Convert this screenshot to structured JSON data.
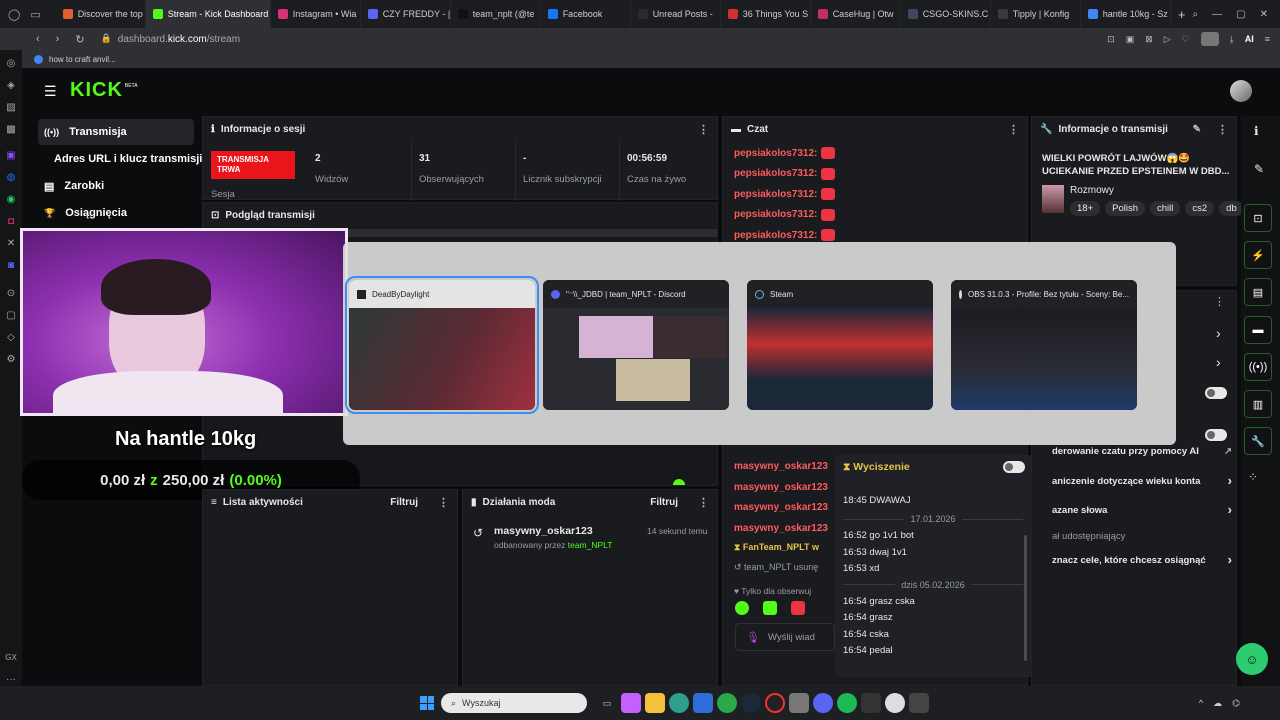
{
  "browser": {
    "tabs": [
      {
        "label": "Discover the top",
        "color": "#e06030"
      },
      {
        "label": "Stream - Kick Dashboard",
        "color": "#53fc18",
        "active": true
      },
      {
        "label": "Instagram • Wia",
        "color": "#d9307a"
      },
      {
        "label": "CZY FREDDY - |",
        "color": "#5865f2"
      },
      {
        "label": "team_nplt (@te",
        "color": "#111111"
      },
      {
        "label": "Facebook",
        "color": "#1877f2"
      },
      {
        "label": "Unread Posts -",
        "color": "#2a2a2a"
      },
      {
        "label": "36 Things You S",
        "color": "#d03030"
      },
      {
        "label": "CaseHug | Otw",
        "color": "#c03060"
      },
      {
        "label": "CSGO-SKINS.C",
        "color": "#404860"
      },
      {
        "label": "Tipply | Konfig",
        "color": "#3a3a3a"
      },
      {
        "label": "hantle 10kg - Sz",
        "color": "#4285f4"
      }
    ],
    "new_tab": "+",
    "url_host": "dashboard.",
    "url_domain": "kick.com",
    "url_path": "/stream",
    "bookmark": "how to craft anvil...",
    "ai_label": "AI"
  },
  "app": {
    "logo": "KICK",
    "logo_badge": "BETA",
    "nav": [
      {
        "icon": "((•))",
        "label": "Transmisja"
      },
      {
        "icon": "",
        "label": "Adres URL i klucz transmisji"
      },
      {
        "icon": "▤",
        "label": "Zarobki"
      },
      {
        "icon": "🏆",
        "label": "Osiągnięcia"
      }
    ],
    "session": {
      "title": "Informacje o sesji",
      "status": "TRANSMISJA TRWA",
      "status_sub": "Sesja",
      "stats": [
        {
          "value": "2",
          "label": "Widzów"
        },
        {
          "value": "31",
          "label": "Obserwujących"
        },
        {
          "value": "-",
          "label": "Licznik subskrypcji"
        },
        {
          "value": "00:56:59",
          "label": "Czas na żywo"
        }
      ]
    },
    "preview_title": "Podgląd transmisji",
    "overlay": {
      "goal_title": "Na hantle 10kg",
      "goal_current": "0,00 zł",
      "goal_sep": "z",
      "goal_target": "250,00 zł",
      "goal_pct": "(0.00%)"
    },
    "activity": {
      "title": "Lista aktywności",
      "filter": "Filtruj"
    },
    "mod": {
      "title": "Działania moda",
      "filter": "Filtruj",
      "user": "masywny_oskar123",
      "time": "14 sekund temu",
      "desc": "odbanowany przez",
      "by": "team_NPLT"
    },
    "chat": {
      "title": "Czat",
      "top_messages": [
        "pepsiakolos7312:",
        "pepsiakolos7312:",
        "pepsiakolos7312:",
        "pepsiakolos7312:",
        "pepsiakolos7312:"
      ],
      "bottom_messages": [
        "masywny_oskar123",
        "masywny_oskar123",
        "masywny_oskar123",
        "masywny_oskar123"
      ],
      "fanteam": "FanTeam_NPLT w",
      "team_line": "team_NPLT usunę",
      "followers_only": "Tylko dla obserwuj",
      "send_placeholder": "Wyślij wiad"
    },
    "timeout": {
      "title": "Wyciszenie",
      "entries": [
        {
          "time": "18:45",
          "text": "DWAWAJ"
        },
        {
          "date": "17.01.2026"
        },
        {
          "time": "16:52",
          "text": "go 1v1 bot"
        },
        {
          "time": "16:53",
          "text": "dwaj 1v1"
        },
        {
          "time": "16:53",
          "text": "xd"
        },
        {
          "date": "dziś 05.02.2026"
        },
        {
          "time": "16:54",
          "text": "grasz cska"
        },
        {
          "time": "16:54",
          "text": "grasz"
        },
        {
          "time": "16:54",
          "text": "cska"
        },
        {
          "time": "16:54",
          "text": "pedal"
        }
      ]
    },
    "stream_info": {
      "title": "Informacje o transmisji",
      "stream_title": "WIELKI POWRÓT LAJWÓW😱🤩 UCIEKANIE PRZED EPSTEINEM W DBD...",
      "category": "Rozmowy",
      "tags": [
        "18+",
        "Polish",
        "chill",
        "cs2",
        "db"
      ]
    },
    "settings_rows": [
      "derowanie czatu przy pomocy AI",
      "aniczenie dotyczące wieku konta",
      "azane słowa",
      "ał udostępniający",
      "znacz cele, które chcesz osiągnąć"
    ]
  },
  "switcher": {
    "windows": [
      {
        "title": "DeadByDaylight",
        "icon": "dbd"
      },
      {
        "title": "\"⁻\\\\_JDBD | team_NPLT - Discord",
        "icon": "discord"
      },
      {
        "title": "Steam",
        "icon": "steam"
      },
      {
        "title": "OBS 31.0.3 - Profile: Bez tytułu - Sceny: Be...",
        "icon": "obs"
      }
    ]
  },
  "taskbar": {
    "search_placeholder": "Wyszukaj",
    "left_label": "GX"
  },
  "colors": {
    "accent": "#53fc18",
    "live_red": "#e9151b",
    "highlight_border": "#3d8ef0"
  }
}
